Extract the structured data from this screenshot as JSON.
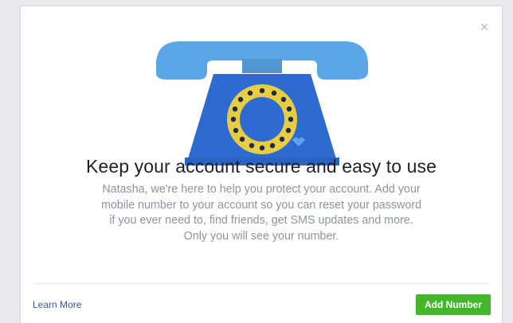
{
  "dialog": {
    "close_icon": "close-icon",
    "illustration_icon": "telephone-icon",
    "title": "Keep your account secure and easy to use",
    "body_lines": [
      "Natasha, we're here to help you protect your account. Add your",
      "mobile number to your account so you can reset your password",
      "if you ever need to, find friends, get SMS updates and more.",
      "Only you will see your number."
    ],
    "learn_more_label": "Learn More",
    "add_number_label": "Add Number"
  },
  "colors": {
    "primary_button": "#42b72a",
    "link": "#365899",
    "title": "#1d2129",
    "body_text": "#8d949e",
    "phone_blue": "#2d6bd1",
    "handset_blue": "#5aa6e6",
    "dial_yellow": "#e8cc43"
  }
}
